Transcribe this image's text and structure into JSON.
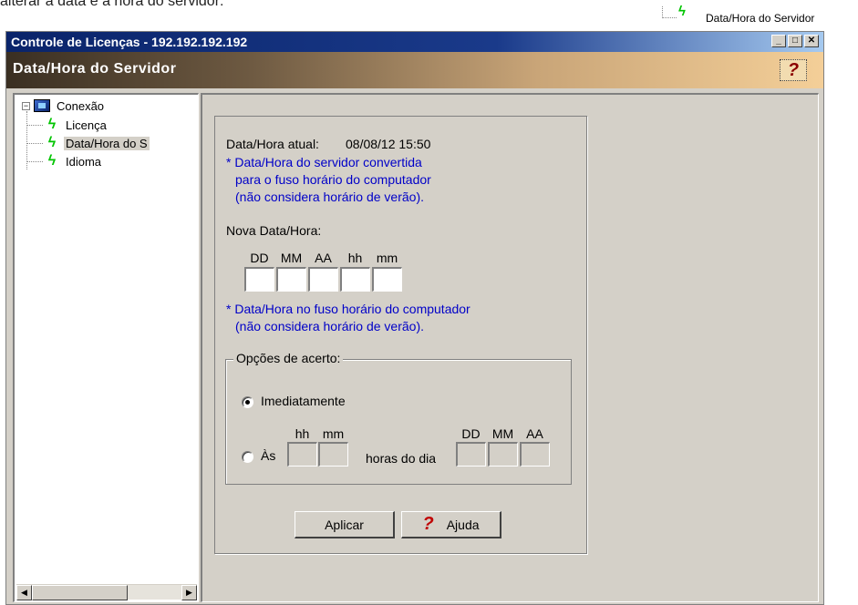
{
  "doc_text": "alterar a data e a hora do servidor:",
  "corner_tree_label": "Data/Hora do Servidor",
  "window": {
    "title": "Controle de Licenças - 192.192.192.192",
    "controls": {
      "minimize": "_",
      "maximize": "□",
      "close": "✕"
    }
  },
  "header": {
    "title": "Data/Hora do Servidor",
    "help_glyph": "?"
  },
  "tree": {
    "root": {
      "label": "Conexão",
      "expander": "−",
      "icon": "network-computer-icon"
    },
    "children": [
      {
        "label": "Licença",
        "icon": "lightning-icon"
      },
      {
        "label": "Data/Hora do S",
        "icon": "lightning-icon",
        "selected": true
      },
      {
        "label": "Idioma",
        "icon": "lightning-icon"
      }
    ],
    "scroll_left": "◀",
    "scroll_right": "▶"
  },
  "form": {
    "current_label": "Data/Hora atual:",
    "current_value": "08/08/12 15:50",
    "note1": [
      "* Data/Hora do servidor convertida",
      "para o fuso horário do computador",
      "(não considera horário de verão)."
    ],
    "new_label": "Nova Data/Hora:",
    "new_columns": [
      "DD",
      "MM",
      "AA",
      "hh",
      "mm"
    ],
    "new_values": [
      "",
      "",
      "",
      "",
      ""
    ],
    "note2": [
      "* Data/Hora no fuso horário do computador",
      "(não considera horário de verão)."
    ],
    "options": {
      "legend": "Opções de acerto:",
      "immediate_label": "Imediatamente",
      "at_label": "Às",
      "time_columns": [
        "hh",
        "mm"
      ],
      "hours_of_day_label": "horas do dia",
      "date_columns": [
        "DD",
        "MM",
        "AA"
      ],
      "selected": "immediate"
    },
    "apply_label": "Aplicar",
    "help_label": "Ajuda",
    "help_glyph": "?"
  },
  "colors": {
    "note_blue": "#0000c8",
    "title_blue": "#0a246a",
    "icon_green": "#00c400"
  }
}
